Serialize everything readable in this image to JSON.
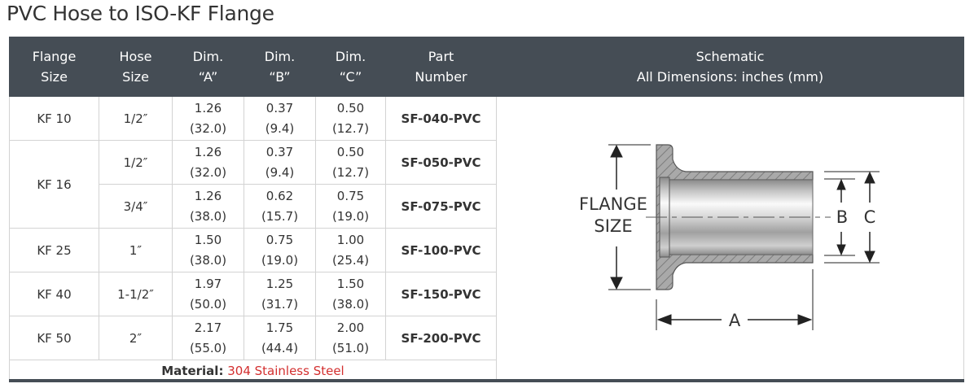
{
  "title": "PVC Hose to ISO-KF Flange",
  "colors": {
    "header_bg": "#454d55",
    "material_accent": "#d32f2f",
    "border": "#d3d3d3"
  },
  "headers": {
    "flange": [
      "Flange",
      "Size"
    ],
    "hose": [
      "Hose",
      "Size"
    ],
    "dim_a": [
      "Dim.",
      "“A”"
    ],
    "dim_b": [
      "Dim.",
      "“B”"
    ],
    "dim_c": [
      "Dim.",
      "“C”"
    ],
    "part": [
      "Part",
      "Number"
    ],
    "schematic": [
      "Schematic",
      "All Dimensions: inches (mm)"
    ]
  },
  "flanges": [
    "KF 10",
    "KF 16",
    "KF 25",
    "KF 40",
    "KF 50"
  ],
  "rows": [
    {
      "hose": "1/2″",
      "a": [
        "1.26",
        "(32.0)"
      ],
      "b": [
        "0.37",
        "(9.4)"
      ],
      "c": [
        "0.50",
        "(12.7)"
      ],
      "part": "SF-040-PVC"
    },
    {
      "hose": "1/2″",
      "a": [
        "1.26",
        "(32.0)"
      ],
      "b": [
        "0.37",
        "(9.4)"
      ],
      "c": [
        "0.50",
        "(12.7)"
      ],
      "part": "SF-050-PVC"
    },
    {
      "hose": "3/4″",
      "a": [
        "1.26",
        "(38.0)"
      ],
      "b": [
        "0.62",
        "(15.7)"
      ],
      "c": [
        "0.75",
        "(19.0)"
      ],
      "part": "SF-075-PVC"
    },
    {
      "hose": "1″",
      "a": [
        "1.50",
        "(38.0)"
      ],
      "b": [
        "0.75",
        "(19.0)"
      ],
      "c": [
        "1.00",
        "(25.4)"
      ],
      "part": "SF-100-PVC"
    },
    {
      "hose": "1-1/2″",
      "a": [
        "1.97",
        "(50.0)"
      ],
      "b": [
        "1.25",
        "(31.7)"
      ],
      "c": [
        "1.50",
        "(38.0)"
      ],
      "part": "SF-150-PVC"
    },
    {
      "hose": "2″",
      "a": [
        "2.17",
        "(55.0)"
      ],
      "b": [
        "1.75",
        "(44.4)"
      ],
      "c": [
        "2.00",
        "(51.0)"
      ],
      "part": "SF-200-PVC"
    }
  ],
  "material": {
    "label": "Material:",
    "value": "304 Stainless Steel"
  },
  "schematic": {
    "flange_label": [
      "FLANGE",
      "SIZE"
    ],
    "a": "A",
    "b": "B",
    "c": "C"
  }
}
